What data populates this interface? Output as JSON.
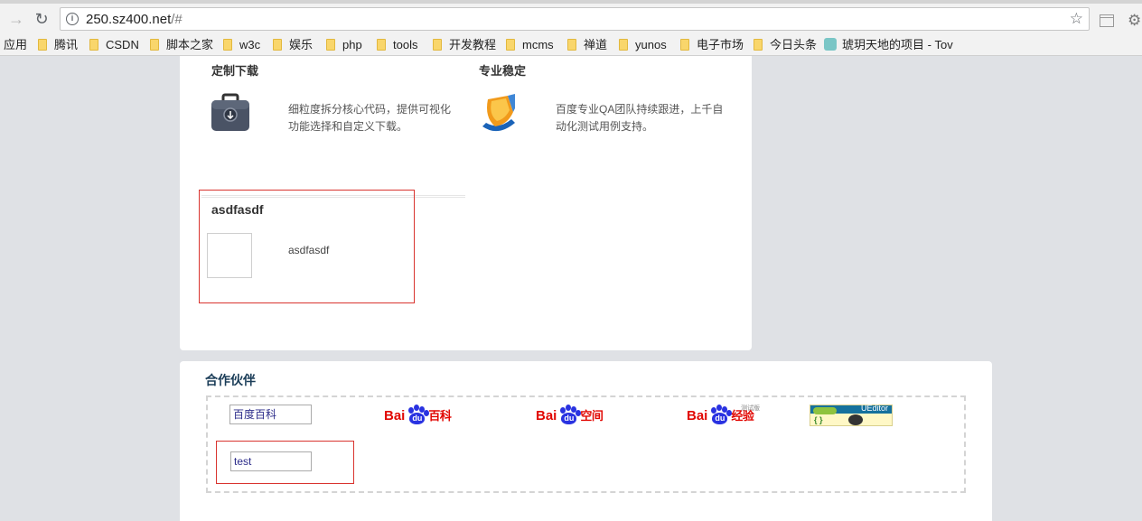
{
  "browser": {
    "url_main": "250.sz400.net",
    "url_hash": "/#",
    "bookmarks": [
      {
        "label": "应用",
        "type": "text"
      },
      {
        "label": "腾讯",
        "type": "folder"
      },
      {
        "label": "CSDN",
        "type": "folder"
      },
      {
        "label": "脚本之家",
        "type": "folder"
      },
      {
        "label": "w3c",
        "type": "folder"
      },
      {
        "label": "娱乐",
        "type": "folder"
      },
      {
        "label": "php",
        "type": "folder"
      },
      {
        "label": "tools",
        "type": "folder"
      },
      {
        "label": "开发教程",
        "type": "folder"
      },
      {
        "label": "mcms",
        "type": "folder"
      },
      {
        "label": "禅道",
        "type": "folder"
      },
      {
        "label": "yunos",
        "type": "folder"
      },
      {
        "label": "电子市场",
        "type": "folder"
      },
      {
        "label": "今日头条",
        "type": "folder"
      },
      {
        "label": "琥玥天地的项目 - Tov",
        "type": "app"
      }
    ]
  },
  "features": [
    {
      "title": "定制下载",
      "desc_line1": "细粒度拆分核心代码，提供可视化",
      "desc_line2": "功能选择和自定义下载。",
      "icon": "briefcase-icon"
    },
    {
      "title": "专业稳定",
      "desc_line1": "百度专业QA团队持续跟进，上千自",
      "desc_line2": "动化测试用例支持。",
      "icon": "shield-icon"
    }
  ],
  "custom_block": {
    "title": "asdfasdf",
    "text": "asdfasdf"
  },
  "partners": {
    "title": "合作伙伴",
    "text_links": [
      "百度百科",
      "test"
    ],
    "logos": [
      {
        "brand": "Bai",
        "paw_text": "du",
        "product": "百科"
      },
      {
        "brand": "Bai",
        "paw_text": "du",
        "product": "空间"
      },
      {
        "brand": "Bai",
        "paw_text": "du",
        "product": "经验",
        "tag": "测试版"
      },
      {
        "brand": "UEditor"
      }
    ]
  },
  "colors": {
    "baidu_red": "#e10601",
    "baidu_blue": "#2932e1",
    "highlight_border": "#d9342f",
    "partners_title": "#1b3d58"
  }
}
